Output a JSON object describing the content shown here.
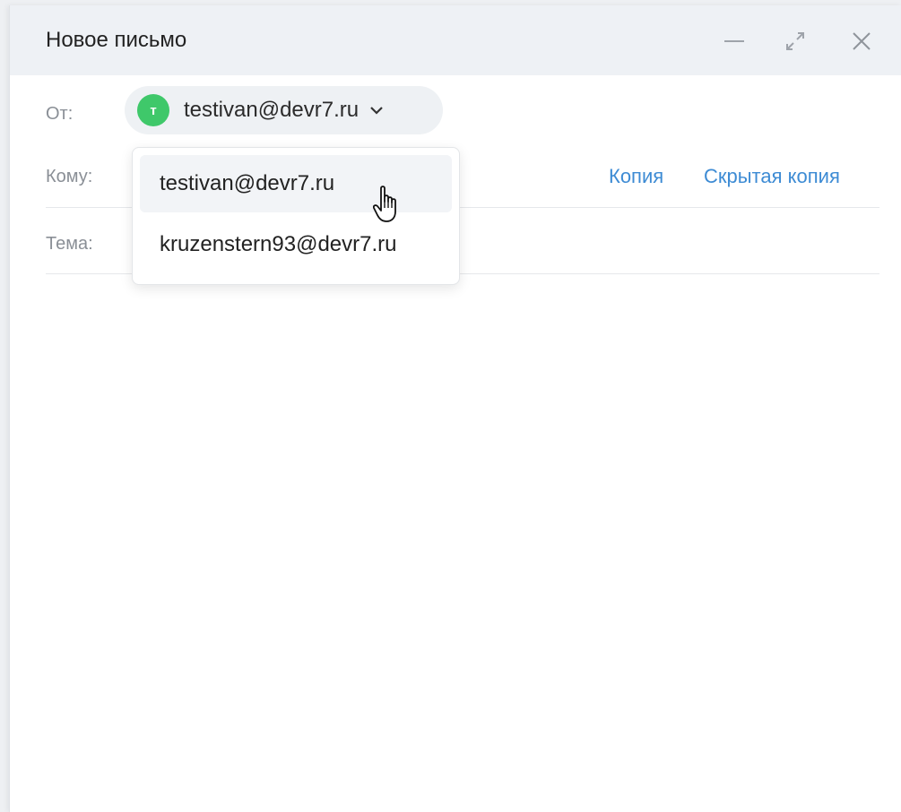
{
  "window": {
    "title": "Новое письмо"
  },
  "window_controls": {
    "minimize_icon": "minimize-icon",
    "expand_icon": "expand-icon",
    "close_icon": "close-icon"
  },
  "from": {
    "label": "От:",
    "avatar_letter": "т",
    "avatar_color": "#3fc86a",
    "selected_email": "testivan@devr7.ru"
  },
  "to": {
    "label": "Кому:",
    "cc_label": "Копия",
    "bcc_label": "Скрытая копия"
  },
  "subject": {
    "label": "Тема:"
  },
  "sender_dropdown": {
    "options": [
      {
        "email": "testivan@devr7.ru"
      },
      {
        "email": "kruzenstern93@devr7.ru"
      }
    ]
  },
  "colors": {
    "accent_link": "#3d8bd4",
    "titlebar_bg": "#eef1f5"
  }
}
